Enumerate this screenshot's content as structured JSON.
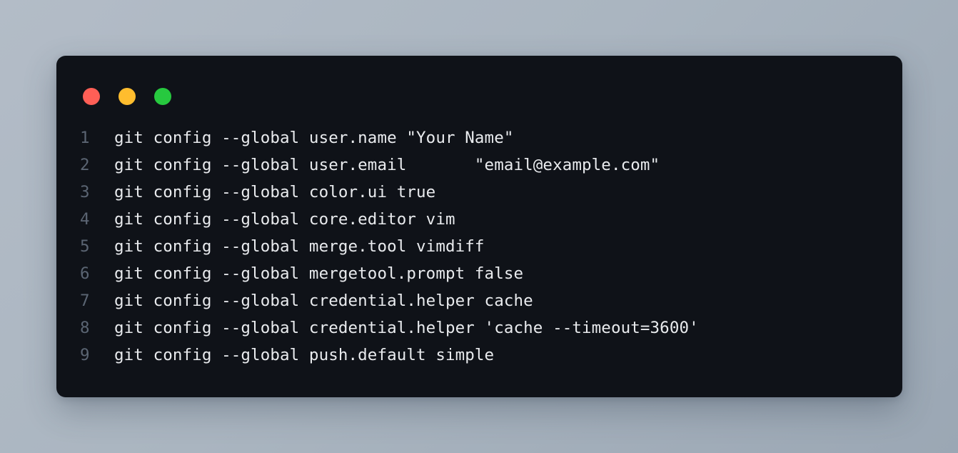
{
  "window": {
    "kind": "terminal-code-snippet",
    "background_color": "#0f1218",
    "page_background_from": "#b3bcc7",
    "page_background_to": "#9ba7b4",
    "text_color": "#e9ebee",
    "line_number_color": "#5b6573"
  },
  "titlebar": {
    "traffic_lights": [
      {
        "name": "close",
        "color": "#ff5f56"
      },
      {
        "name": "minimize",
        "color": "#ffbd2e"
      },
      {
        "name": "maximize",
        "color": "#27c93f"
      }
    ]
  },
  "code": {
    "language": "shell",
    "lines": [
      {
        "number": "1",
        "text": "git config --global user.name \"Your Name\""
      },
      {
        "number": "2",
        "text": "git config --global user.email       \"email@example.com\""
      },
      {
        "number": "3",
        "text": "git config --global color.ui true"
      },
      {
        "number": "4",
        "text": "git config --global core.editor vim"
      },
      {
        "number": "5",
        "text": "git config --global merge.tool vimdiff"
      },
      {
        "number": "6",
        "text": "git config --global mergetool.prompt false"
      },
      {
        "number": "7",
        "text": "git config --global credential.helper cache"
      },
      {
        "number": "8",
        "text": "git config --global credential.helper 'cache --timeout=3600'"
      },
      {
        "number": "9",
        "text": "git config --global push.default simple"
      }
    ]
  }
}
